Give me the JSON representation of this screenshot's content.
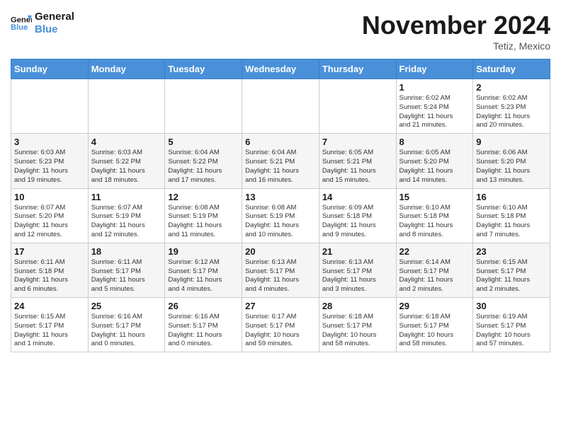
{
  "header": {
    "logo_line1": "General",
    "logo_line2": "Blue",
    "month_title": "November 2024",
    "location": "Tetiz, Mexico"
  },
  "weekdays": [
    "Sunday",
    "Monday",
    "Tuesday",
    "Wednesday",
    "Thursday",
    "Friday",
    "Saturday"
  ],
  "weeks": [
    [
      {
        "day": "",
        "info": ""
      },
      {
        "day": "",
        "info": ""
      },
      {
        "day": "",
        "info": ""
      },
      {
        "day": "",
        "info": ""
      },
      {
        "day": "",
        "info": ""
      },
      {
        "day": "1",
        "info": "Sunrise: 6:02 AM\nSunset: 5:24 PM\nDaylight: 11 hours\nand 21 minutes."
      },
      {
        "day": "2",
        "info": "Sunrise: 6:02 AM\nSunset: 5:23 PM\nDaylight: 11 hours\nand 20 minutes."
      }
    ],
    [
      {
        "day": "3",
        "info": "Sunrise: 6:03 AM\nSunset: 5:23 PM\nDaylight: 11 hours\nand 19 minutes."
      },
      {
        "day": "4",
        "info": "Sunrise: 6:03 AM\nSunset: 5:22 PM\nDaylight: 11 hours\nand 18 minutes."
      },
      {
        "day": "5",
        "info": "Sunrise: 6:04 AM\nSunset: 5:22 PM\nDaylight: 11 hours\nand 17 minutes."
      },
      {
        "day": "6",
        "info": "Sunrise: 6:04 AM\nSunset: 5:21 PM\nDaylight: 11 hours\nand 16 minutes."
      },
      {
        "day": "7",
        "info": "Sunrise: 6:05 AM\nSunset: 5:21 PM\nDaylight: 11 hours\nand 15 minutes."
      },
      {
        "day": "8",
        "info": "Sunrise: 6:05 AM\nSunset: 5:20 PM\nDaylight: 11 hours\nand 14 minutes."
      },
      {
        "day": "9",
        "info": "Sunrise: 6:06 AM\nSunset: 5:20 PM\nDaylight: 11 hours\nand 13 minutes."
      }
    ],
    [
      {
        "day": "10",
        "info": "Sunrise: 6:07 AM\nSunset: 5:20 PM\nDaylight: 11 hours\nand 12 minutes."
      },
      {
        "day": "11",
        "info": "Sunrise: 6:07 AM\nSunset: 5:19 PM\nDaylight: 11 hours\nand 12 minutes."
      },
      {
        "day": "12",
        "info": "Sunrise: 6:08 AM\nSunset: 5:19 PM\nDaylight: 11 hours\nand 11 minutes."
      },
      {
        "day": "13",
        "info": "Sunrise: 6:08 AM\nSunset: 5:19 PM\nDaylight: 11 hours\nand 10 minutes."
      },
      {
        "day": "14",
        "info": "Sunrise: 6:09 AM\nSunset: 5:18 PM\nDaylight: 11 hours\nand 9 minutes."
      },
      {
        "day": "15",
        "info": "Sunrise: 6:10 AM\nSunset: 5:18 PM\nDaylight: 11 hours\nand 8 minutes."
      },
      {
        "day": "16",
        "info": "Sunrise: 6:10 AM\nSunset: 5:18 PM\nDaylight: 11 hours\nand 7 minutes."
      }
    ],
    [
      {
        "day": "17",
        "info": "Sunrise: 6:11 AM\nSunset: 5:18 PM\nDaylight: 11 hours\nand 6 minutes."
      },
      {
        "day": "18",
        "info": "Sunrise: 6:11 AM\nSunset: 5:17 PM\nDaylight: 11 hours\nand 5 minutes."
      },
      {
        "day": "19",
        "info": "Sunrise: 6:12 AM\nSunset: 5:17 PM\nDaylight: 11 hours\nand 4 minutes."
      },
      {
        "day": "20",
        "info": "Sunrise: 6:13 AM\nSunset: 5:17 PM\nDaylight: 11 hours\nand 4 minutes."
      },
      {
        "day": "21",
        "info": "Sunrise: 6:13 AM\nSunset: 5:17 PM\nDaylight: 11 hours\nand 3 minutes."
      },
      {
        "day": "22",
        "info": "Sunrise: 6:14 AM\nSunset: 5:17 PM\nDaylight: 11 hours\nand 2 minutes."
      },
      {
        "day": "23",
        "info": "Sunrise: 6:15 AM\nSunset: 5:17 PM\nDaylight: 11 hours\nand 2 minutes."
      }
    ],
    [
      {
        "day": "24",
        "info": "Sunrise: 6:15 AM\nSunset: 5:17 PM\nDaylight: 11 hours\nand 1 minute."
      },
      {
        "day": "25",
        "info": "Sunrise: 6:16 AM\nSunset: 5:17 PM\nDaylight: 11 hours\nand 0 minutes."
      },
      {
        "day": "26",
        "info": "Sunrise: 6:16 AM\nSunset: 5:17 PM\nDaylight: 11 hours\nand 0 minutes."
      },
      {
        "day": "27",
        "info": "Sunrise: 6:17 AM\nSunset: 5:17 PM\nDaylight: 10 hours\nand 59 minutes."
      },
      {
        "day": "28",
        "info": "Sunrise: 6:18 AM\nSunset: 5:17 PM\nDaylight: 10 hours\nand 58 minutes."
      },
      {
        "day": "29",
        "info": "Sunrise: 6:18 AM\nSunset: 5:17 PM\nDaylight: 10 hours\nand 58 minutes."
      },
      {
        "day": "30",
        "info": "Sunrise: 6:19 AM\nSunset: 5:17 PM\nDaylight: 10 hours\nand 57 minutes."
      }
    ]
  ]
}
